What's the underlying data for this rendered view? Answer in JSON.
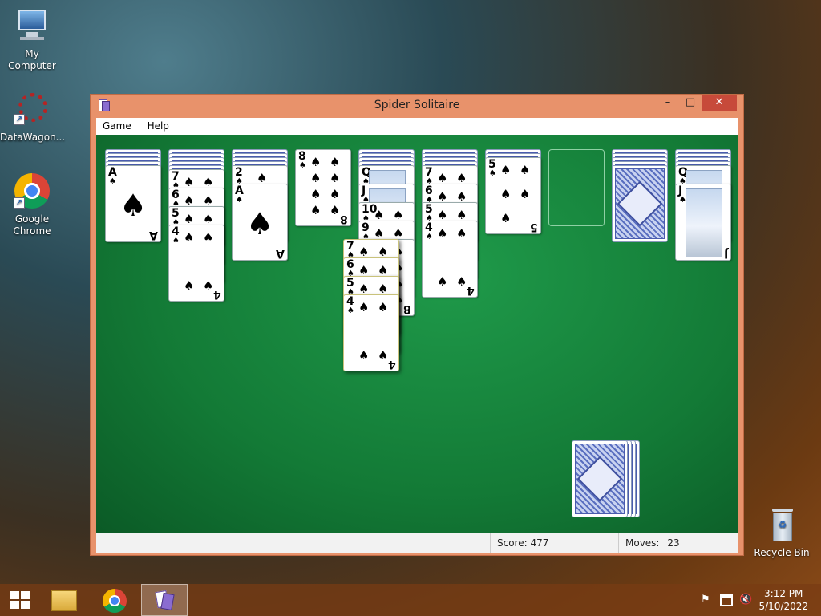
{
  "desktop": {
    "icons": [
      {
        "label": "My Computer"
      },
      {
        "label": "DataWagon..."
      },
      {
        "label": "Google Chrome"
      },
      {
        "label": "Recycle Bin"
      }
    ]
  },
  "window": {
    "title": "Spider Solitaire",
    "minimize_label": "–",
    "maximize_label": "□",
    "close_label": "✕",
    "menu": [
      "Game",
      "Help"
    ]
  },
  "game": {
    "suit_symbol": "♠",
    "columns": [
      {
        "hidden": 4,
        "visible": [
          "A"
        ]
      },
      {
        "hidden": 5,
        "visible": [
          "7",
          "6",
          "5",
          "4"
        ]
      },
      {
        "hidden": 4,
        "visible": [
          "2",
          "A"
        ]
      },
      {
        "hidden": 0,
        "visible": [
          "8"
        ]
      },
      {
        "hidden": 4,
        "visible": [
          "Q",
          "J",
          "10",
          "9",
          "8"
        ]
      },
      {
        "hidden": 4,
        "visible": [
          "7",
          "6",
          "5",
          "4"
        ]
      },
      {
        "hidden": 2,
        "visible": [
          "5"
        ]
      },
      {
        "hidden": 0,
        "visible": []
      },
      {
        "hidden": 5,
        "visible": []
      },
      {
        "hidden": 4,
        "visible": [
          "Q",
          "J"
        ]
      }
    ],
    "dragging": [
      "7",
      "6",
      "5",
      "4"
    ],
    "stock_piles": 4
  },
  "status": {
    "score_label": "Score:",
    "score": "477",
    "moves_label": "Moves:",
    "moves": "23"
  },
  "taskbar": {
    "time": "3:12 PM",
    "date": "5/10/2022"
  }
}
